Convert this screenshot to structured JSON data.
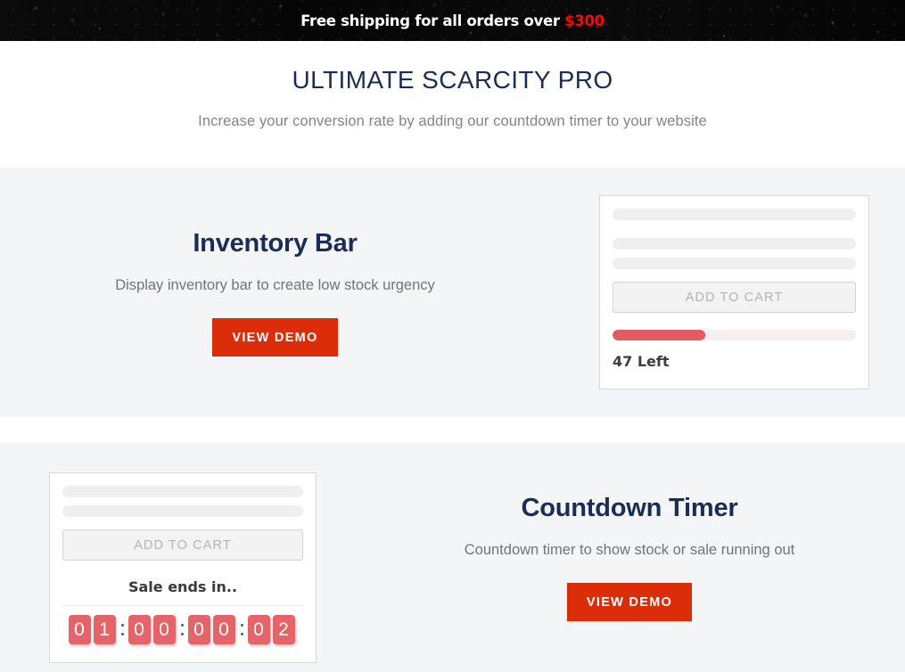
{
  "announcement": {
    "text_before": "Free shipping for all orders over ",
    "amount": "$300",
    "amount_color": "#fb0707"
  },
  "hero": {
    "title": "ULTIMATE SCARCITY PRO",
    "subtitle": "Increase your conversion rate by adding our countdown timer to your website",
    "title_color": "#1c2d55"
  },
  "features": [
    {
      "title": "Inventory Bar",
      "description": "Display inventory bar to create low stock urgency",
      "button_label": "VIEW DEMO",
      "button_color": "#dc2d0a"
    },
    {
      "title": "Countdown Timer",
      "description": "Countdown timer to show stock or sale running out",
      "button_label": "VIEW DEMO",
      "button_color": "#dc2d0a"
    }
  ],
  "inventory_card": {
    "add_to_cart_label": "ADD TO CART",
    "progress_percent": 38,
    "progress_fill_color": "#e15b61",
    "progress_track_color": "#f7eeee",
    "stock_text": "47 Left"
  },
  "timer_card": {
    "add_to_cart_label": "ADD TO CART",
    "sale_label": "Sale ends in..",
    "digit_color": "#e4646a",
    "separator_color": "#4a5d7e",
    "digits": [
      "0",
      "1",
      "0",
      "0",
      "0",
      "0",
      "0",
      "2"
    ],
    "time_display": "01:00:00:02"
  }
}
